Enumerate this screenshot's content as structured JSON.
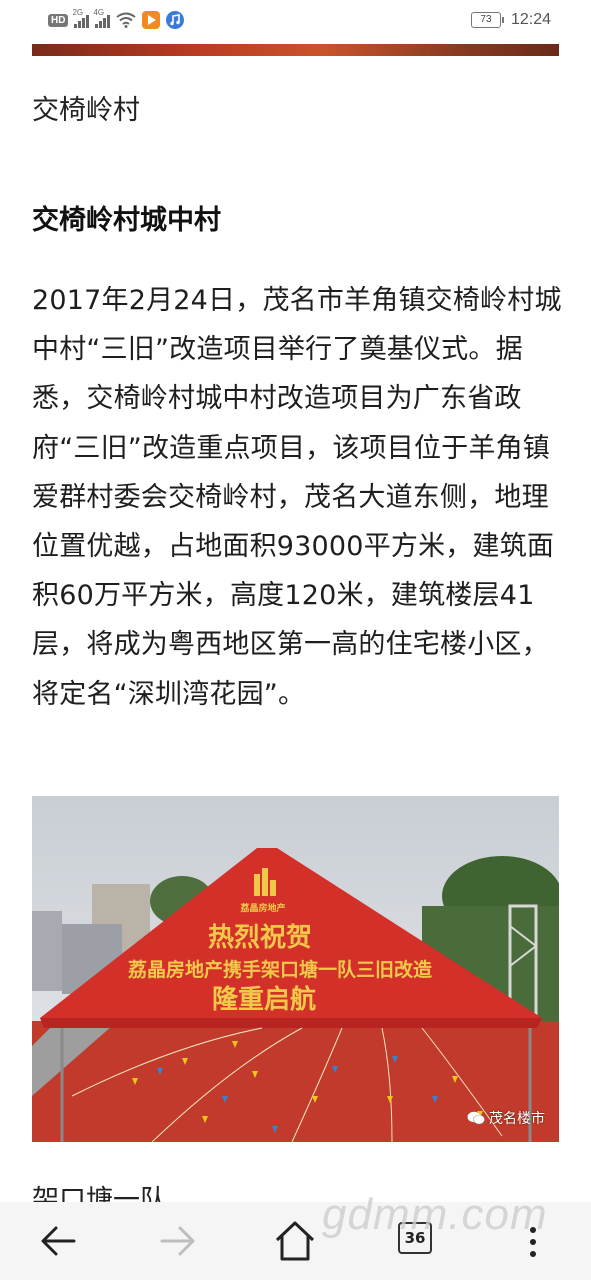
{
  "status_bar": {
    "hd_badge": "HD",
    "signal1_label": "2G",
    "signal2_label": "4G",
    "battery": "73",
    "time": "12:24"
  },
  "article": {
    "caption": "交椅岭村",
    "heading": "交椅岭村城中村",
    "paragraph": "2017年2月24日，茂名市羊角镇交椅岭村城中村“三旧”改造项目举行了奠基仪式。据悉，交椅岭村城中村改造项目为广东省政府“三旧”改造重点项目，该项目位于羊角镇爱群村委会交椅岭村，茂名大道东侧，地理位置优越，占地面积93000平方米，建筑面积60万平方米，高度120米，建筑楼层41层，将成为粤西地区第一高的住宅楼小区，将定名“深圳湾花园”。",
    "photo": {
      "brand": "荔晶房地产",
      "line1": "热烈祝贺",
      "line2": "荔晶房地产携手架口塘一队三旧改造",
      "line3": "隆重启航",
      "watermark": "茂名楼市"
    },
    "next_caption": "架口塘一队"
  },
  "navbar": {
    "tab_count": "36",
    "site_watermark": "gdmm.com"
  },
  "icons": [
    "back-arrow-icon",
    "forward-arrow-icon",
    "home-icon",
    "tabs-icon",
    "more-vertical-icon",
    "wifi-icon",
    "battery-icon"
  ]
}
